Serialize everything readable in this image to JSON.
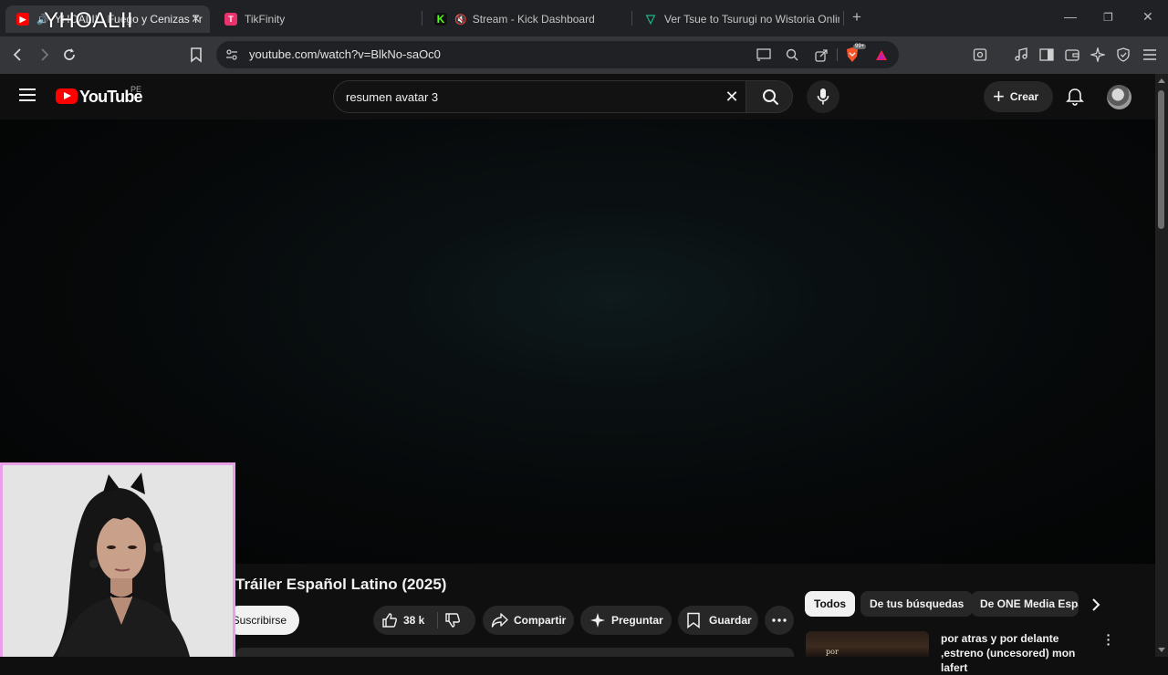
{
  "browser": {
    "overlay_name": "YHOALII",
    "tabs": [
      {
        "label": "YHOALII - Fuego y Cenizas Tr",
        "favicon_color": "#ff0000"
      },
      {
        "label": "TikFinity",
        "favicon_color": "#e8336d"
      },
      {
        "label": "Stream - Kick Dashboard",
        "favicon_color": "#53fc18"
      },
      {
        "label": "Ver Tsue to Tsurugi no Wistoria Onlin",
        "favicon_color": "#1fb38a"
      }
    ],
    "new_tab_icon": "plus-icon",
    "url": "youtube.com/watch?v=BlkNo-saOc0",
    "brave_badge": "99+"
  },
  "youtube": {
    "logo_text": "YouTube",
    "region": "PE",
    "search_query": "resumen avatar 3",
    "create_label": "Crear"
  },
  "video": {
    "title": "Tráiler Español Latino (2025)",
    "subscribe_label": "Suscribirse",
    "like_count": "38 k",
    "share_label": "Compartir",
    "ask_label": "Preguntar",
    "save_label": "Guardar"
  },
  "sidebar": {
    "chips": [
      "Todos",
      "De tus búsquedas",
      "De ONE Media Españ"
    ],
    "recommendation": {
      "title": "por atras y por delante ,estreno (uncesored) mon lafert",
      "thumb_text": "por"
    }
  },
  "colors": {
    "youtube_red": "#ff0000",
    "webcam_border": "#e8a0e6"
  }
}
